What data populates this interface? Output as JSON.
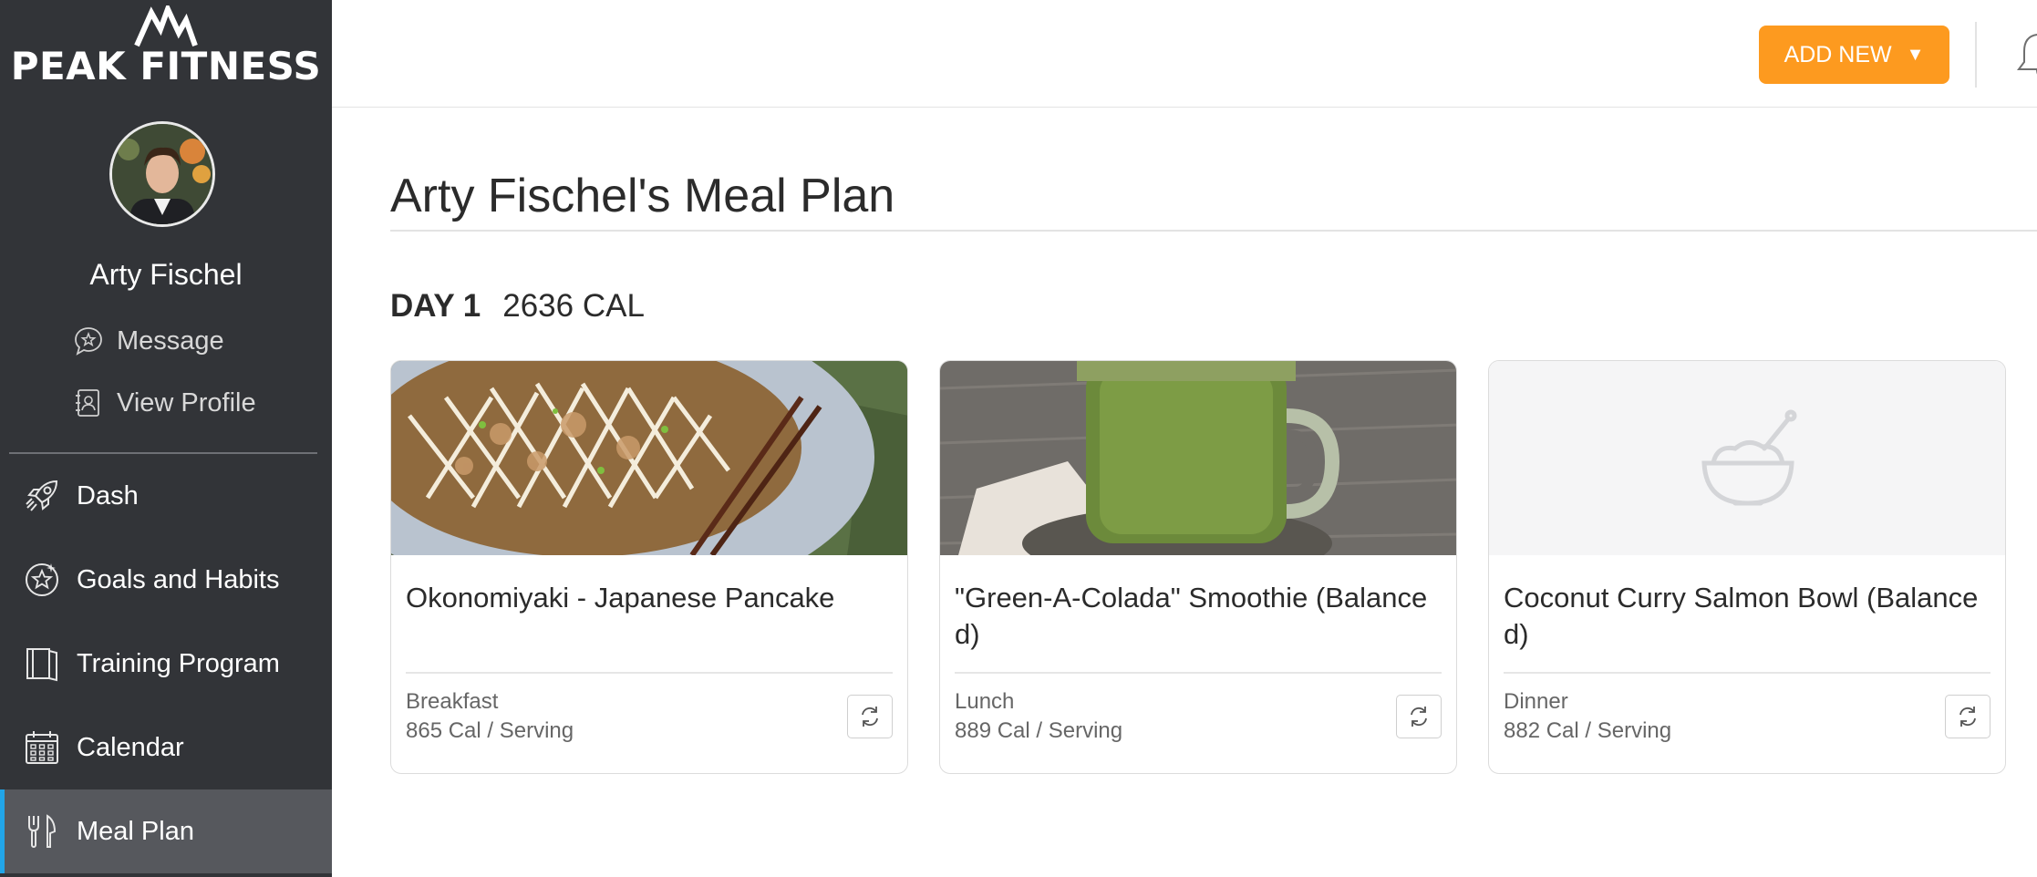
{
  "brand": {
    "name": "PEAK FITNESS"
  },
  "user": {
    "name": "Arty Fischel"
  },
  "sidebar": {
    "links": [
      {
        "label": "Message",
        "icon": "chat-star-icon"
      },
      {
        "label": "View Profile",
        "icon": "contact-book-icon"
      }
    ],
    "nav": [
      {
        "label": "Dash",
        "icon": "rocket-icon",
        "active": false
      },
      {
        "label": "Goals and Habits",
        "icon": "star-badge-icon",
        "active": false
      },
      {
        "label": "Training Program",
        "icon": "book-icon",
        "active": false
      },
      {
        "label": "Calendar",
        "icon": "calendar-icon",
        "active": false
      },
      {
        "label": "Meal Plan",
        "icon": "fork-knife-icon",
        "active": true
      }
    ]
  },
  "topbar": {
    "add_new_label": "ADD NEW",
    "add_new_caret": "▼"
  },
  "page": {
    "title": "Arty Fischel's Meal Plan"
  },
  "day": {
    "label": "DAY 1",
    "calories": "2636 CAL"
  },
  "meals": [
    {
      "title": "Okonomiyaki - Japanese Pancake",
      "type": "Breakfast",
      "calories": "865 Cal / Serving",
      "image": "okonomiyaki-photo"
    },
    {
      "title": "\"Green-A-Colada\" Smoothie (Balanced)",
      "type": "Lunch",
      "calories": "889 Cal / Serving",
      "image": "green-smoothie-photo"
    },
    {
      "title": "Coconut Curry Salmon Bowl (Balanced)",
      "type": "Dinner",
      "calories": "882 Cal / Serving",
      "image": "placeholder-bowl-icon"
    }
  ],
  "colors": {
    "sidebar_bg": "#323438",
    "active_nav_bg": "#56585d",
    "active_nav_accent": "#21a5e8",
    "add_new_button": "#fd9a1f"
  }
}
